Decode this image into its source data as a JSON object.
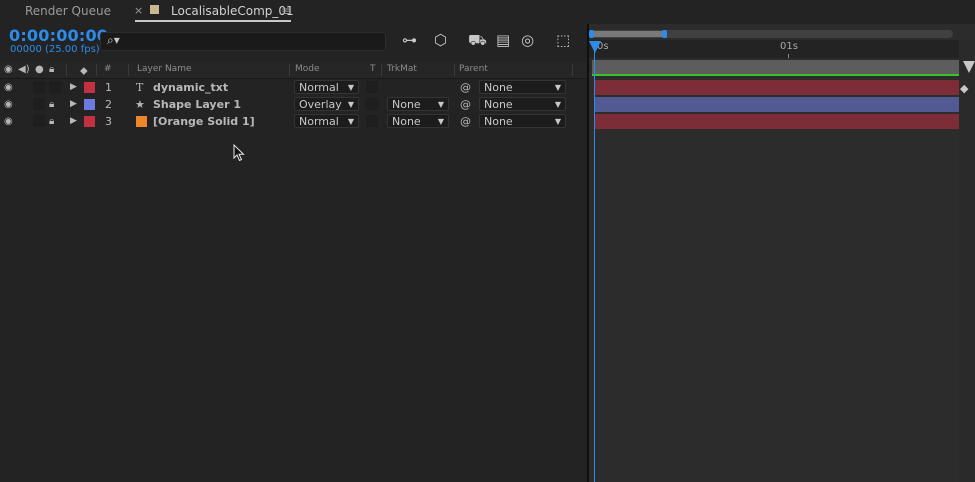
{
  "tabs": {
    "render_queue": "Render Queue",
    "close": "×",
    "comp": "LocalisableComp_01",
    "menu": "≡"
  },
  "comp": {
    "timecode": "0:00:00:00",
    "frames": "00000 (25.00 fps)",
    "search_placeholder": ""
  },
  "columns": {
    "number": "#",
    "layer_name": "Layer Name",
    "mode": "Mode",
    "t": "T",
    "trkmat": "TrkMat",
    "parent": "Parent"
  },
  "layers": [
    {
      "num": "1",
      "type_icon": "T",
      "name": "dynamic_txt",
      "mode": "Normal",
      "trkmat": "",
      "parent": "None",
      "label_color": "#c2313f",
      "bar_color": "#7d2d37",
      "locked": false
    },
    {
      "num": "2",
      "type_icon": "★",
      "name": "Shape Layer 1",
      "mode": "Overlay",
      "trkmat": "None",
      "parent": "None",
      "label_color": "#6b7be0",
      "bar_color": "#515a92",
      "locked": true
    },
    {
      "num": "3",
      "type_icon": "",
      "name": "[Orange Solid 1]",
      "mode": "Normal",
      "trkmat": "None",
      "parent": "None",
      "label_color": "#c2313f",
      "bar_color": "#7d2d37",
      "solid_color": "#f0862a",
      "locked": true
    }
  ],
  "timeline": {
    "ruler_start": "0s",
    "ruler_mark": "01s"
  },
  "colors": {
    "accent": "#2d8ceb",
    "work_area_bar": "#39c22a"
  }
}
